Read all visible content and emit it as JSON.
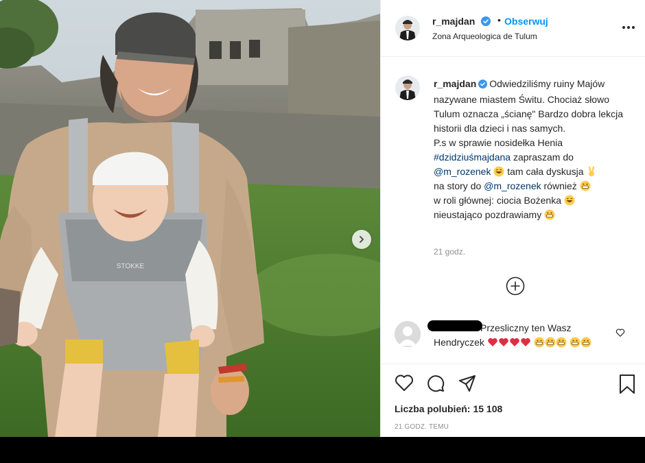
{
  "post": {
    "username": "r_majdan",
    "dot": "•",
    "follow_label": "Obserwuj",
    "location": "Zona Arqueologica de Tulum",
    "carrier_brand": "STOKKE"
  },
  "caption": {
    "username": "r_majdan",
    "line1": "Odwiedziliśmy ruiny Majów nazywane miastem Świtu. Chociaż słowo Tulum oznacza „ścianę\" Bardzo dobra lekcja historii dla dzieci i nas samych.",
    "line2": "P.s w sprawie nosidełka Henia",
    "hashtag": "#dzidziuśmajdana",
    "text_a": "zapraszam do",
    "mention1": "@m_rozenek",
    "text_b": "tam cała dyskusja",
    "text_c": "na story do",
    "mention2": "@m_rozenek",
    "text_d": "również",
    "text_e": "w roli głównej: ciocia Bożenka",
    "text_f": "nieustająco pozdrawiamy",
    "time": "21 godz."
  },
  "comment": {
    "text": "Przesliczny ten Wasz Hendryczek"
  },
  "engagement": {
    "likes_label": "Liczba polubień:",
    "likes_count": "15 108",
    "time_ago": "21 godz. temu"
  },
  "icons": {
    "verified": "verified-badge-icon",
    "more": "more-options-icon",
    "next": "chevron-right-icon",
    "load_more": "plus-circle-icon",
    "like": "heart-icon",
    "comment": "comment-bubble-icon",
    "share": "paper-plane-icon",
    "save": "bookmark-icon"
  },
  "colors": {
    "link": "#0095f6",
    "mention": "#00376b",
    "verified": "#3897f0",
    "heart_red": "#ed4956",
    "muted": "#8e8e8e"
  }
}
